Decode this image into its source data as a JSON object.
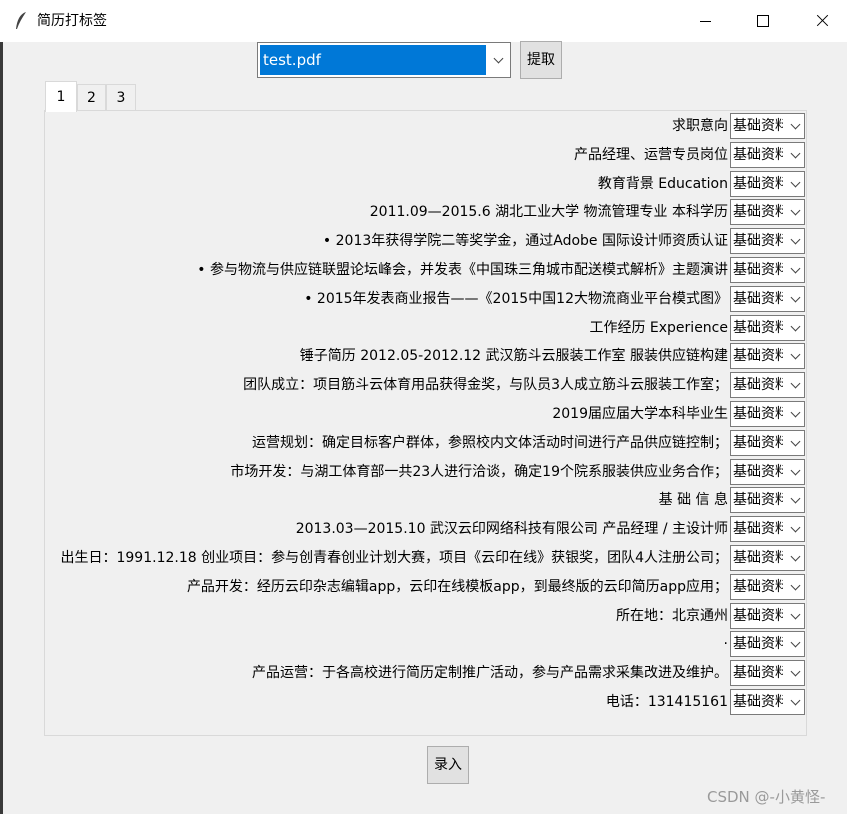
{
  "window": {
    "title": "简历打标签",
    "icon": "feather-icon"
  },
  "file_select": {
    "value": "test.pdf"
  },
  "extract_button": "提取",
  "tabs": [
    "1",
    "2",
    "3"
  ],
  "active_tab": "1",
  "rows": [
    {
      "text": "求职意向",
      "tag": "基础资料"
    },
    {
      "text": "产品经理、运营专员岗位",
      "tag": "基础资料"
    },
    {
      "text": "教育背景 Education",
      "tag": "基础资料"
    },
    {
      "text": "2011.09—2015.6 湖北工业大学 物流管理专业 本科学历",
      "tag": "基础资料"
    },
    {
      "text": "• 2013年获得学院二等奖学金，通过Adobe 国际设计师资质认证",
      "tag": "基础资料"
    },
    {
      "text": "• 参与物流与供应链联盟论坛峰会，并发表《中国珠三角城市配送模式解析》主题演讲",
      "tag": "基础资料"
    },
    {
      "text": "• 2015年发表商业报告——《2015中国12大物流商业平台模式图》",
      "tag": "基础资料"
    },
    {
      "text": "工作经历 Experience",
      "tag": "基础资料"
    },
    {
      "text": "锤子简历 2012.05-2012.12 武汉筋斗云服装工作室 服装供应链构建",
      "tag": "基础资料"
    },
    {
      "text": "团队成立：项目筋斗云体育用品获得金奖，与队员3人成立筋斗云服装工作室；",
      "tag": "基础资料"
    },
    {
      "text": "2019届应届大学本科毕业生",
      "tag": "基础资料"
    },
    {
      "text": "运营规划：确定目标客户群体，参照校内文体活动时间进行产品供应链控制；",
      "tag": "基础资料"
    },
    {
      "text": "市场开发：与湖工体育部一共23人进行洽谈，确定19个院系服装供应业务合作；",
      "tag": "基础资料"
    },
    {
      "text": "基 础 信 息",
      "tag": "基础资料"
    },
    {
      "text": "2013.03—2015.10 武汉云印网络科技有限公司 产品经理 / 主设计师",
      "tag": "基础资料"
    },
    {
      "text": "出生日：1991.12.18 创业项目：参与创青春创业计划大赛，项目《云印在线》获银奖，团队4人注册公司；",
      "tag": "基础资料"
    },
    {
      "text": "产品开发：经历云印杂志编辑app，云印在线模板app，到最终版的云印简历app应用；",
      "tag": "基础资料"
    },
    {
      "text": "所在地：北京通州",
      "tag": "基础资料"
    },
    {
      "text": "·",
      "tag": "基础资料"
    },
    {
      "text": "产品运营：于各高校进行简历定制推广活动，参与产品需求采集改进及维护。",
      "tag": "基础资料"
    },
    {
      "text": "电话：131415161",
      "tag": "基础资料"
    }
  ],
  "enter_button": "录入",
  "watermark": "CSDN @-小黄怪-",
  "colors": {
    "selection_blue": "#0078d7",
    "window_bg": "#f0f0f0"
  }
}
